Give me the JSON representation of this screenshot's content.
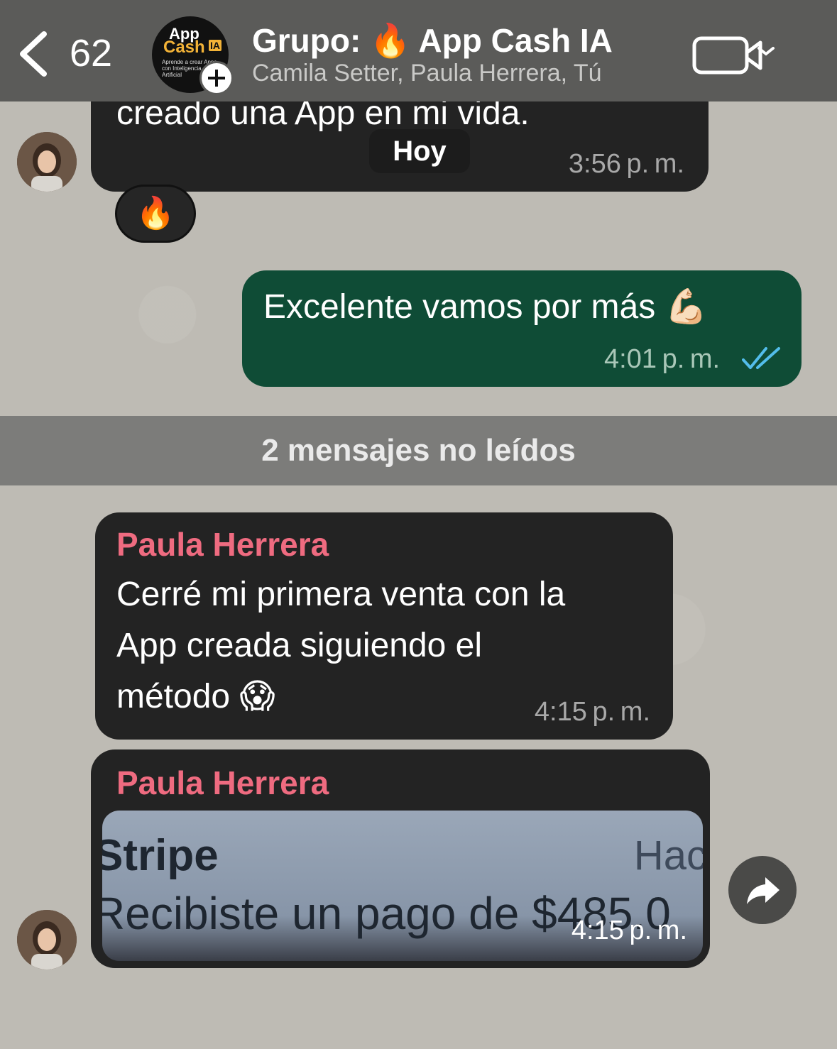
{
  "header": {
    "back_count": "62",
    "title": "Grupo: 🔥 App Cash IA",
    "subtitle": "Camila Setter, Paula Herrera, Tú",
    "group_avatar": {
      "app": "App",
      "cash": "Cash",
      "ia": "IA",
      "tagline": "Aprende a crear Apps con Inteligencia Artificial"
    }
  },
  "messages": {
    "m1": {
      "text": "creado una App en mi vida.",
      "time": "3:56 p. m.",
      "reaction": "🔥"
    },
    "date_chip": "Hoy",
    "m2": {
      "text": "Excelente vamos por más 💪🏻",
      "time": "4:01 p. m."
    },
    "unread_banner": "2 mensajes no leídos",
    "m3": {
      "sender": "Paula Herrera",
      "text_lines": [
        "Cerré mi primera venta con la",
        "App creada siguiendo el",
        "método 😱"
      ],
      "time": "4:15 p. m."
    },
    "m4": {
      "sender": "Paula Herrera",
      "image_stripe": "Stripe",
      "image_hac": "Hac",
      "image_pago": "Recibiste un pago de $485.0",
      "time": "4:15 p. m."
    }
  },
  "colors": {
    "header_bg": "#5b5b59",
    "sender": "#ef6b80",
    "outgoing": "#0f4c36",
    "incoming": "#232323",
    "read_ticks": "#53bdeb"
  },
  "icons": [
    "chevron-left-icon",
    "plus-icon",
    "video-call-icon",
    "chevron-down-icon",
    "double-check-icon",
    "forward-icon"
  ]
}
